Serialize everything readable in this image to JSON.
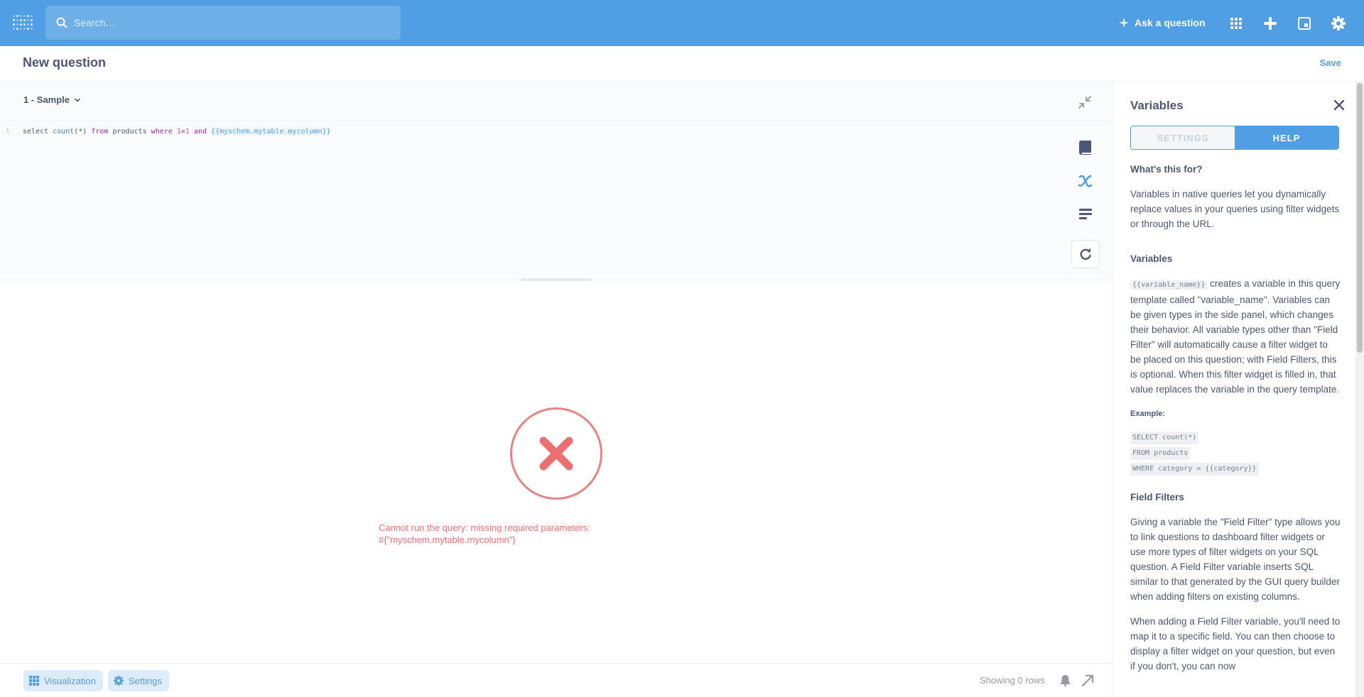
{
  "nav": {
    "search_placeholder": "Search…",
    "ask_label": "Ask a question",
    "icons": [
      "grid-icon",
      "plus-icon",
      "snippet-icon",
      "gear-icon"
    ]
  },
  "header": {
    "title": "New question",
    "save_label": "Save"
  },
  "editor": {
    "database": "1 - Sample",
    "line_number": "1",
    "query": {
      "p1": "select ",
      "p2": "count",
      "p3": "(*) ",
      "p4": "from",
      "p5": " products ",
      "p6": "where",
      "p7": " ",
      "p8": "1",
      "p9": "=",
      "p10": "1",
      "p11": " ",
      "p12": "and",
      "p13": " ",
      "p14": "{{myschem.mytable.mycolumn}}"
    }
  },
  "result": {
    "error_line1": "Cannot run the query: missing required parameters:",
    "error_line2": "#{\"myschem.mytable.mycolumn\"}"
  },
  "footer": {
    "visualization_label": "Visualization",
    "settings_label": "Settings",
    "rows_label": "Showing 0 rows"
  },
  "sidebar": {
    "title": "Variables",
    "tab_settings": "SETTINGS",
    "tab_help": "HELP",
    "h_whats_this": "What's this for?",
    "p_whats_this": "Variables in native queries let you dynamically replace values in your queries using filter widgets or through the URL.",
    "h_variables": "Variables",
    "var_code": "{{variable_name}}",
    "p_variables": " creates a variable in this query template called \"variable_name\". Variables can be given types in the side panel, which changes their behavior. All variable types other than \"Field Filter\" will automatically cause a filter widget to be placed on this question; with Field Filters, this is optional. When this filter widget is filled in, that value replaces the variable in the query template.",
    "example_label": "Example:",
    "example_lines": [
      "SELECT count(*)",
      "FROM products",
      "WHERE category = {{category}}"
    ],
    "h_field_filters": "Field Filters",
    "p_field_filters_1": "Giving a variable the \"Field Filter\" type allows you to link questions to dashboard filter widgets or use more types of filter widgets on your SQL question. A Field Filter variable inserts SQL similar to that generated by the GUI query builder when adding filters on existing columns.",
    "p_field_filters_2": "When adding a Field Filter variable, you'll need to map it to a specific field. You can then choose to display a filter widget on your question, but even if you don't, you can now"
  }
}
